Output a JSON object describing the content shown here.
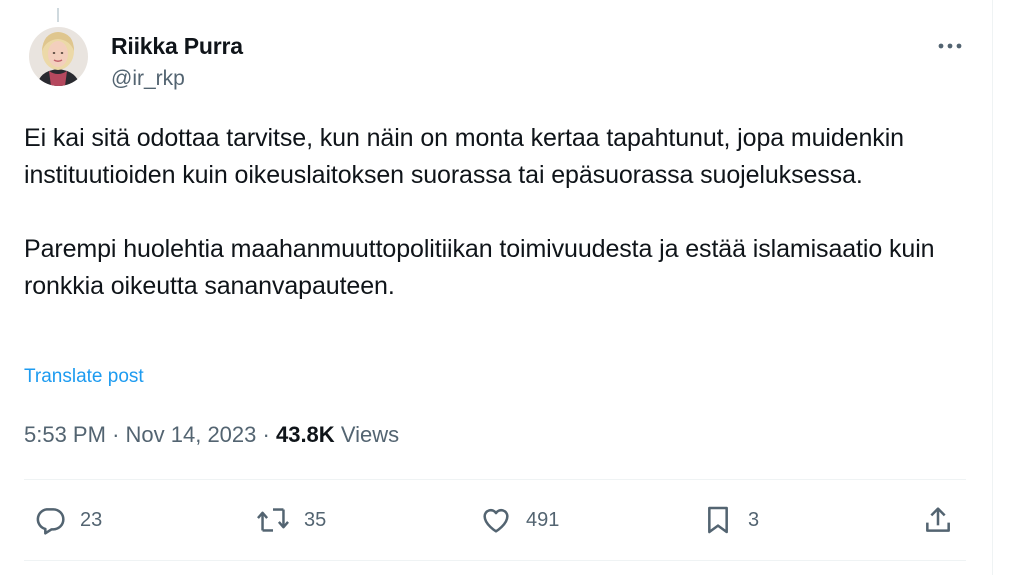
{
  "author": {
    "name": "Riikka Purra",
    "handle": "@ir_rkp"
  },
  "tweet": {
    "paragraphs": [
      "Ei kai sitä odottaa tarvitse, kun näin on monta kertaa tapahtunut, jopa muidenkin instituutioiden kuin oikeuslaitoksen suorassa tai epäsuorassa suojeluksessa.",
      "Parempi huolehtia maahanmuuttopolitiikan toimivuudesta ja estää islamisaatio kuin ronkkia oikeutta sananvapauteen."
    ],
    "translate_label": "Translate post",
    "time": "5:53 PM",
    "separator": "·",
    "date": "Nov 14, 2023",
    "views_count": "43.8K",
    "views_label": "Views"
  },
  "actions": {
    "replies": "23",
    "reposts": "35",
    "likes": "491",
    "bookmarks": "3"
  },
  "icons": {
    "more": "more-horizontal-icon",
    "reply": "reply-bubble-icon",
    "repost": "repost-icon",
    "like": "heart-icon",
    "bookmark": "bookmark-icon",
    "share": "share-upload-icon"
  },
  "colors": {
    "text": "#0f1419",
    "secondary": "#536471",
    "link": "#1d9bf0",
    "divider": "#eff3f4"
  }
}
